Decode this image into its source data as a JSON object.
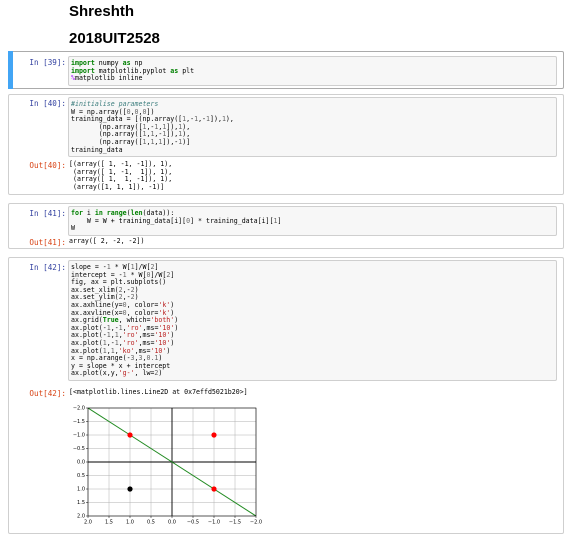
{
  "header": {
    "name": "Shreshth",
    "roll": "2018UIT2528"
  },
  "cells": [
    {
      "in_prompt": "In [39]:",
      "code": [
        [
          [
            "import",
            "kw"
          ],
          [
            " numpy ",
            ""
          ],
          [
            "as",
            "kw"
          ],
          [
            " np",
            ""
          ]
        ],
        [
          [
            "import",
            "kw"
          ],
          [
            " matplotlib.pyplot ",
            ""
          ],
          [
            "as",
            "kw"
          ],
          [
            " plt",
            ""
          ]
        ],
        [
          [
            "%",
            "mg"
          ],
          [
            "matplotlib inline",
            ""
          ]
        ]
      ]
    },
    {
      "in_prompt": "In [40]:",
      "code": [
        [
          [
            "#initialise parameters",
            "cm"
          ]
        ],
        [
          [
            "W = np.array([",
            ""
          ],
          [
            "0",
            "num"
          ],
          [
            ",",
            ""
          ],
          [
            "0",
            "num"
          ],
          [
            ",",
            ""
          ],
          [
            "0",
            "num"
          ],
          [
            "])",
            ""
          ]
        ],
        [
          [
            "training_data = [(np.array([",
            ""
          ],
          [
            "1",
            "num"
          ],
          [
            ",-",
            ""
          ],
          [
            "1",
            "num"
          ],
          [
            ",-",
            ""
          ],
          [
            "1",
            "num"
          ],
          [
            "]),",
            ""
          ],
          [
            "1",
            "num"
          ],
          [
            "),",
            ""
          ]
        ],
        [
          [
            "       (np.array([",
            ""
          ],
          [
            "1",
            "num"
          ],
          [
            ",-",
            ""
          ],
          [
            "1",
            "num"
          ],
          [
            ",",
            ""
          ],
          [
            "1",
            "num"
          ],
          [
            "]),",
            ""
          ],
          [
            "1",
            "num"
          ],
          [
            "),",
            ""
          ]
        ],
        [
          [
            "       (np.array([",
            ""
          ],
          [
            "1",
            "num"
          ],
          [
            ",",
            ""
          ],
          [
            "1",
            "num"
          ],
          [
            ",-",
            ""
          ],
          [
            "1",
            "num"
          ],
          [
            "]),",
            ""
          ],
          [
            "1",
            "num"
          ],
          [
            "),",
            ""
          ]
        ],
        [
          [
            "       (np.array([",
            ""
          ],
          [
            "1",
            "num"
          ],
          [
            ",",
            ""
          ],
          [
            "1",
            "num"
          ],
          [
            ",",
            ""
          ],
          [
            "1",
            "num"
          ],
          [
            "]),-",
            ""
          ],
          [
            "1",
            "num"
          ],
          [
            ")]",
            ""
          ]
        ],
        [
          [
            "training_data",
            ""
          ]
        ]
      ],
      "out_prompt": "Out[40]:",
      "output": [
        "[(array([ 1, -1, -1]), 1),",
        " (array([ 1, -1,  1]), 1),",
        " (array([ 1,  1, -1]), 1),",
        " (array([1, 1, 1]), -1)]"
      ]
    },
    {
      "in_prompt": "In [41]:",
      "code": [
        [
          [
            "for",
            "kw"
          ],
          [
            " i ",
            ""
          ],
          [
            "in",
            "kw"
          ],
          [
            " ",
            ""
          ],
          [
            "range",
            "kw"
          ],
          [
            "(",
            ""
          ],
          [
            "len",
            "kw"
          ],
          [
            "(data)):",
            ""
          ]
        ],
        [
          [
            "    W = W + training_data[i][",
            ""
          ],
          [
            "0",
            "num"
          ],
          [
            "] * training_data[i][",
            ""
          ],
          [
            "1",
            "num"
          ],
          [
            "]",
            ""
          ]
        ],
        [
          [
            "W",
            ""
          ]
        ]
      ],
      "out_prompt": "Out[41]:",
      "output": [
        "array([ 2, -2, -2])"
      ]
    },
    {
      "in_prompt": "In [42]:",
      "code": [
        [
          [
            "slope = -",
            ""
          ],
          [
            "1",
            "num"
          ],
          [
            " * W[",
            ""
          ],
          [
            "1",
            "num"
          ],
          [
            "]/W[",
            ""
          ],
          [
            "2",
            "num"
          ],
          [
            "]",
            ""
          ]
        ],
        [
          [
            "intercept = -",
            ""
          ],
          [
            "1",
            "num"
          ],
          [
            " * W[",
            ""
          ],
          [
            "0",
            "num"
          ],
          [
            "]/W[",
            ""
          ],
          [
            "2",
            "num"
          ],
          [
            "]",
            ""
          ]
        ],
        [
          [
            "fig, ax = plt.subplots()",
            ""
          ]
        ],
        [
          [
            "ax.set_xlim(",
            ""
          ],
          [
            "2",
            "num"
          ],
          [
            ",-",
            ""
          ],
          [
            "2",
            "num"
          ],
          [
            ")",
            ""
          ]
        ],
        [
          [
            "ax.set_ylim(",
            ""
          ],
          [
            "2",
            "num"
          ],
          [
            ",-",
            ""
          ],
          [
            "2",
            "num"
          ],
          [
            ")",
            ""
          ]
        ],
        [
          [
            "ax.axhline(y=",
            ""
          ],
          [
            "0",
            "num"
          ],
          [
            ", color=",
            ""
          ],
          [
            "'k'",
            "str"
          ],
          [
            ")",
            ""
          ]
        ],
        [
          [
            "ax.axvline(x=",
            ""
          ],
          [
            "0",
            "num"
          ],
          [
            ", color=",
            ""
          ],
          [
            "'k'",
            "str"
          ],
          [
            ")",
            ""
          ]
        ],
        [
          [
            "ax.grid(",
            ""
          ],
          [
            "True",
            "kw"
          ],
          [
            ", which=",
            ""
          ],
          [
            "'both'",
            "str"
          ],
          [
            ")",
            ""
          ]
        ],
        [
          [
            "ax.plot(-",
            ""
          ],
          [
            "1",
            "num"
          ],
          [
            ",-",
            ""
          ],
          [
            "1",
            "num"
          ],
          [
            ",",
            ""
          ],
          [
            "'ro'",
            "str"
          ],
          [
            ",ms=",
            ""
          ],
          [
            "'10'",
            "str"
          ],
          [
            ")",
            ""
          ]
        ],
        [
          [
            "ax.plot(-",
            ""
          ],
          [
            "1",
            "num"
          ],
          [
            ",",
            ""
          ],
          [
            "1",
            "num"
          ],
          [
            ",",
            ""
          ],
          [
            "'ro'",
            "str"
          ],
          [
            ",ms=",
            ""
          ],
          [
            "'10'",
            "str"
          ],
          [
            ")",
            ""
          ]
        ],
        [
          [
            "ax.plot(",
            ""
          ],
          [
            "1",
            "num"
          ],
          [
            ",-",
            ""
          ],
          [
            "1",
            "num"
          ],
          [
            ",",
            ""
          ],
          [
            "'ro'",
            "str"
          ],
          [
            ",ms=",
            ""
          ],
          [
            "'10'",
            "str"
          ],
          [
            ")",
            ""
          ]
        ],
        [
          [
            "ax.plot(",
            ""
          ],
          [
            "1",
            "num"
          ],
          [
            ",",
            ""
          ],
          [
            "1",
            "num"
          ],
          [
            ",",
            ""
          ],
          [
            "'ko'",
            "str"
          ],
          [
            ",ms=",
            ""
          ],
          [
            "'10'",
            "str"
          ],
          [
            ")",
            ""
          ]
        ],
        [
          [
            "x = np.arange(-",
            ""
          ],
          [
            "3",
            "num"
          ],
          [
            ",",
            ""
          ],
          [
            "3",
            "num"
          ],
          [
            ",",
            ""
          ],
          [
            "0.1",
            "num"
          ],
          [
            ")",
            ""
          ]
        ],
        [
          [
            "y = slope * x + intercept",
            ""
          ]
        ],
        [
          [
            "ax.plot(x,y,",
            ""
          ],
          [
            "'g-'",
            "str"
          ],
          [
            ", lw=",
            ""
          ],
          [
            "2",
            "num"
          ],
          [
            ")",
            ""
          ]
        ]
      ],
      "out_prompt": "Out[42]:",
      "output": [
        "[<matplotlib.lines.Line2D at 0x7effd5021b20>]"
      ]
    }
  ],
  "chart_data": {
    "type": "scatter",
    "xlim": [
      2,
      -2
    ],
    "ylim": [
      2,
      -2
    ],
    "x_ticks": [
      2.0,
      1.5,
      1.0,
      0.5,
      0.0,
      -0.5,
      -1.0,
      -1.5,
      -2.0
    ],
    "x_tick_labels": [
      "2.0",
      "1.5",
      "1.0",
      "0.5",
      "0.0",
      "−0.5",
      "−1.0",
      "−1.5",
      "−2.0"
    ],
    "y_ticks": [
      -2.0,
      -1.5,
      -1.0,
      -0.5,
      0.0,
      0.5,
      1.0,
      1.5,
      2.0
    ],
    "y_tick_labels": [
      "−2.0",
      "−1.5",
      "−1.0",
      "−0.5",
      "0.0",
      "0.5",
      "1.0",
      "1.5",
      "2.0"
    ],
    "grid": true,
    "axhline": 0,
    "axvline": 0,
    "points": [
      {
        "x": -1,
        "y": -1,
        "color": "#ff0000"
      },
      {
        "x": -1,
        "y": 1,
        "color": "#ff0000"
      },
      {
        "x": 1,
        "y": -1,
        "color": "#ff0000"
      },
      {
        "x": 1,
        "y": 1,
        "color": "#000000"
      }
    ],
    "line": {
      "slope": -1,
      "intercept": 0,
      "x_start": -3,
      "x_end": 3,
      "color": "#228b22"
    },
    "colors": {
      "grid": "#b0b0b0",
      "axis": "#000000"
    }
  }
}
